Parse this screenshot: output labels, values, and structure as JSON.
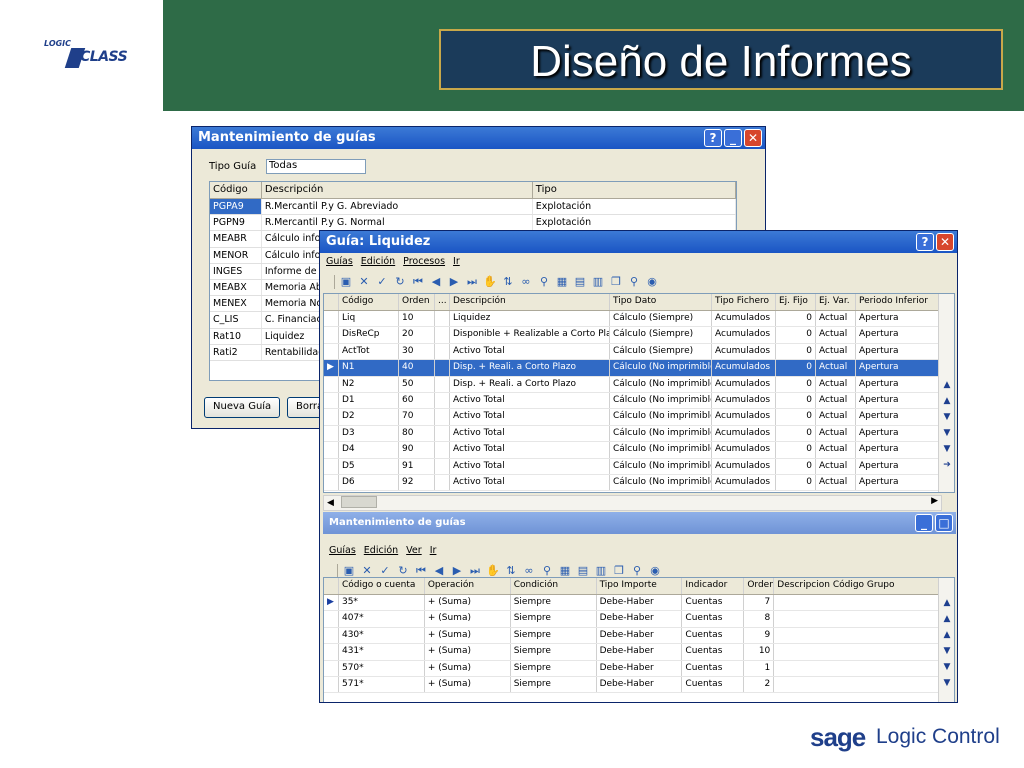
{
  "slide": {
    "title": "Diseño de Informes",
    "logo_small": "LOGIC",
    "logo_big": "CLASS",
    "footer_brand": "sage",
    "footer_brand_rest": "Logic Control",
    "colors": {
      "header": "#2e6b47",
      "title_box": "#1b3b5a",
      "title_border": "#c8a84a",
      "selection": "#316ac5"
    }
  },
  "win1": {
    "title": "Mantenimiento de guías",
    "tipo_label": "Tipo Guía",
    "tipo_value": "Todas",
    "columns": [
      "Código",
      "Descripción",
      "Tipo"
    ],
    "rows": [
      [
        "PGPA9",
        "R.Mercantil P.y G. Abreviado",
        "Explotación"
      ],
      [
        "PGPN9",
        "R.Mercantil P.y G. Normal",
        "Explotación"
      ],
      [
        "MEABR",
        "Cálculo infor",
        ""
      ],
      [
        "MENOR",
        "Cálculo infor",
        ""
      ],
      [
        "INGES",
        "Informe de c",
        ""
      ],
      [
        "MEABX",
        "Memoria Abr",
        ""
      ],
      [
        "MENEX",
        "Memoria Nor",
        ""
      ],
      [
        "C_LIS",
        "C. Financiac",
        ""
      ],
      [
        "Rat10",
        "Liquidez",
        ""
      ],
      [
        "Rati2",
        "Rentabilidad",
        ""
      ]
    ],
    "btn_new": "Nueva Guía",
    "btn_delete": "Borrar"
  },
  "win2": {
    "title": "Guía: Liquidez",
    "menu": [
      "Guías",
      "Edición",
      "Procesos",
      "Ir"
    ],
    "columns": [
      "Código",
      "Orden",
      "...",
      "Descripción",
      "Tipo Dato",
      "Tipo Fichero",
      "Ej. Fijo",
      "Ej. Var.",
      "Periodo Inferior"
    ],
    "rows": [
      [
        "Liq",
        "10",
        "",
        "Liquidez",
        "Cálculo (Siempre)",
        "Acumulados",
        "0",
        "Actual",
        "Apertura"
      ],
      [
        "DisReCp",
        "20",
        "",
        "Disponible + Realizable a Corto Plazo",
        "Cálculo (Siempre)",
        "Acumulados",
        "0",
        "Actual",
        "Apertura"
      ],
      [
        "ActTot",
        "30",
        "",
        "Activo Total",
        "Cálculo (Siempre)",
        "Acumulados",
        "0",
        "Actual",
        "Apertura"
      ],
      [
        "N1",
        "40",
        "",
        "Disp. + Reali. a Corto Plazo",
        "Cálculo (No imprimible)",
        "Acumulados",
        "0",
        "Actual",
        "Apertura"
      ],
      [
        "N2",
        "50",
        "",
        "Disp. + Reali. a Corto Plazo",
        "Cálculo (No imprimible)",
        "Acumulados",
        "0",
        "Actual",
        "Apertura"
      ],
      [
        "D1",
        "60",
        "",
        "Activo Total",
        "Cálculo (No imprimible)",
        "Acumulados",
        "0",
        "Actual",
        "Apertura"
      ],
      [
        "D2",
        "70",
        "",
        "Activo Total",
        "Cálculo (No imprimible)",
        "Acumulados",
        "0",
        "Actual",
        "Apertura"
      ],
      [
        "D3",
        "80",
        "",
        "Activo Total",
        "Cálculo (No imprimible)",
        "Acumulados",
        "0",
        "Actual",
        "Apertura"
      ],
      [
        "D4",
        "90",
        "",
        "Activo Total",
        "Cálculo (No imprimible)",
        "Acumulados",
        "0",
        "Actual",
        "Apertura"
      ],
      [
        "D5",
        "91",
        "",
        "Activo Total",
        "Cálculo (No imprimible)",
        "Acumulados",
        "0",
        "Actual",
        "Apertura"
      ],
      [
        "D6",
        "92",
        "",
        "Activo Total",
        "Cálculo (No imprimible)",
        "Acumulados",
        "0",
        "Actual",
        "Apertura"
      ]
    ],
    "selected_row": 3,
    "sub_title": "Mantenimiento de guías",
    "sub_menu": [
      "Guías",
      "Edición",
      "Ver",
      "Ir"
    ],
    "sub_columns": [
      "Código o cuenta",
      "Operación",
      "Condición",
      "Tipo Importe",
      "Indicador",
      "Orden",
      "Descripcion Código Grupo"
    ],
    "sub_rows": [
      [
        "35*",
        "+ (Suma)",
        "Siempre",
        "Debe-Haber",
        "Cuentas",
        "7",
        ""
      ],
      [
        "407*",
        "+ (Suma)",
        "Siempre",
        "Debe-Haber",
        "Cuentas",
        "8",
        ""
      ],
      [
        "430*",
        "+ (Suma)",
        "Siempre",
        "Debe-Haber",
        "Cuentas",
        "9",
        ""
      ],
      [
        "431*",
        "+ (Suma)",
        "Siempre",
        "Debe-Haber",
        "Cuentas",
        "10",
        ""
      ],
      [
        "570*",
        "+ (Suma)",
        "Siempre",
        "Debe-Haber",
        "Cuentas",
        "1",
        ""
      ],
      [
        "571*",
        "+ (Suma)",
        "Siempre",
        "Debe-Haber",
        "Cuentas",
        "2",
        ""
      ]
    ],
    "toolbar_icons": [
      "save-icon",
      "delete-icon",
      "check-icon",
      "refresh-icon",
      "first-icon",
      "prev-icon",
      "next-icon",
      "last-icon",
      "hand-icon",
      "sort-icon",
      "link-icon",
      "filter-icon",
      "grid-icon",
      "print-icon",
      "export-icon",
      "copy-icon",
      "search-icon",
      "zoom-icon"
    ]
  }
}
